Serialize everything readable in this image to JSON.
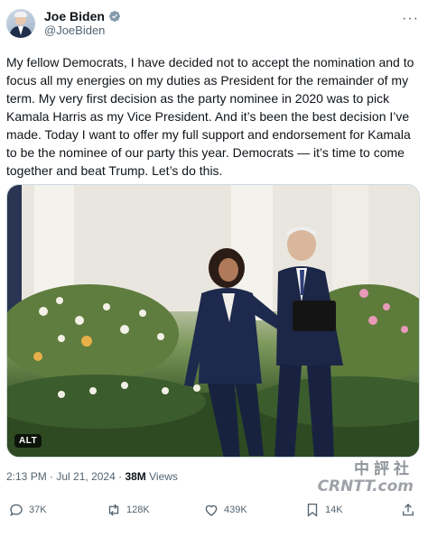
{
  "author": {
    "display_name": "Joe Biden",
    "handle": "@JoeBiden",
    "avatar_icon": "avatar",
    "verified_icon": "verified-badge-icon",
    "verified_color": "#829aab"
  },
  "tweet": {
    "text": "My fellow Democrats, I have decided not to accept the nomination and to focus all my energies on my duties as President for the remainder of my term. My very first decision as the party nominee in 2020 was to pick Kamala Harris as my Vice President. And it’s been the best decision I’ve made. Today I want to offer my full support and endorsement for Kamala to be the nominee of our party this year. Democrats — it’s time to come together and beat Trump. Let’s do this.",
    "media": {
      "alt_label": "ALT"
    }
  },
  "meta": {
    "time": "2:13 PM",
    "separator": " · ",
    "date": "Jul 21, 2024",
    "views_count": "38M",
    "views_label": "Views"
  },
  "actions": {
    "replies": "37K",
    "reposts": "128K",
    "likes": "439K",
    "bookmarks": "14K",
    "icons": [
      "reply-icon",
      "repost-icon",
      "like-icon",
      "bookmark-icon",
      "share-icon"
    ]
  },
  "watermark": {
    "line1": "中評社",
    "line2": "CRNTT.com"
  }
}
